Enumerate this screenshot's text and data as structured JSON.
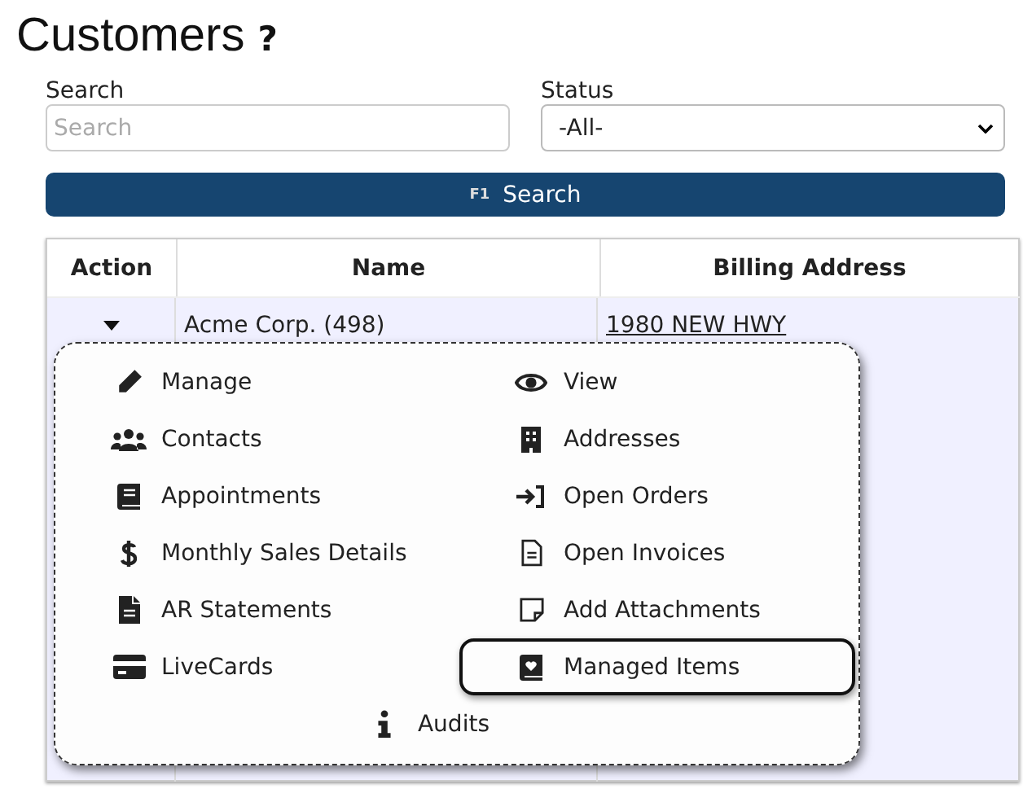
{
  "page": {
    "title": "Customers",
    "help": "?"
  },
  "filters": {
    "search": {
      "label": "Search",
      "placeholder": "Search"
    },
    "status": {
      "label": "Status",
      "value": "-All-"
    }
  },
  "search_button": {
    "shortcut": "F1",
    "label": "Search"
  },
  "table": {
    "columns": [
      "Action",
      "Name",
      "Billing Address"
    ],
    "rows": [
      {
        "name": "Acme Corp. (498)",
        "address": "1980 NEW HWY"
      }
    ]
  },
  "action_menu": {
    "items": [
      {
        "label": "Manage",
        "selected": false
      },
      {
        "label": "View",
        "selected": false
      },
      {
        "label": "Contacts",
        "selected": false
      },
      {
        "label": "Addresses",
        "selected": false
      },
      {
        "label": "Appointments",
        "selected": false
      },
      {
        "label": "Open Orders",
        "selected": false
      },
      {
        "label": "Monthly Sales Details",
        "selected": false
      },
      {
        "label": "Open Invoices",
        "selected": false
      },
      {
        "label": "AR Statements",
        "selected": false
      },
      {
        "label": "Add Attachments",
        "selected": false
      },
      {
        "label": "LiveCards",
        "selected": false
      },
      {
        "label": "Managed Items",
        "selected": true
      }
    ],
    "footer_item": {
      "label": "Audits",
      "selected": false
    }
  }
}
